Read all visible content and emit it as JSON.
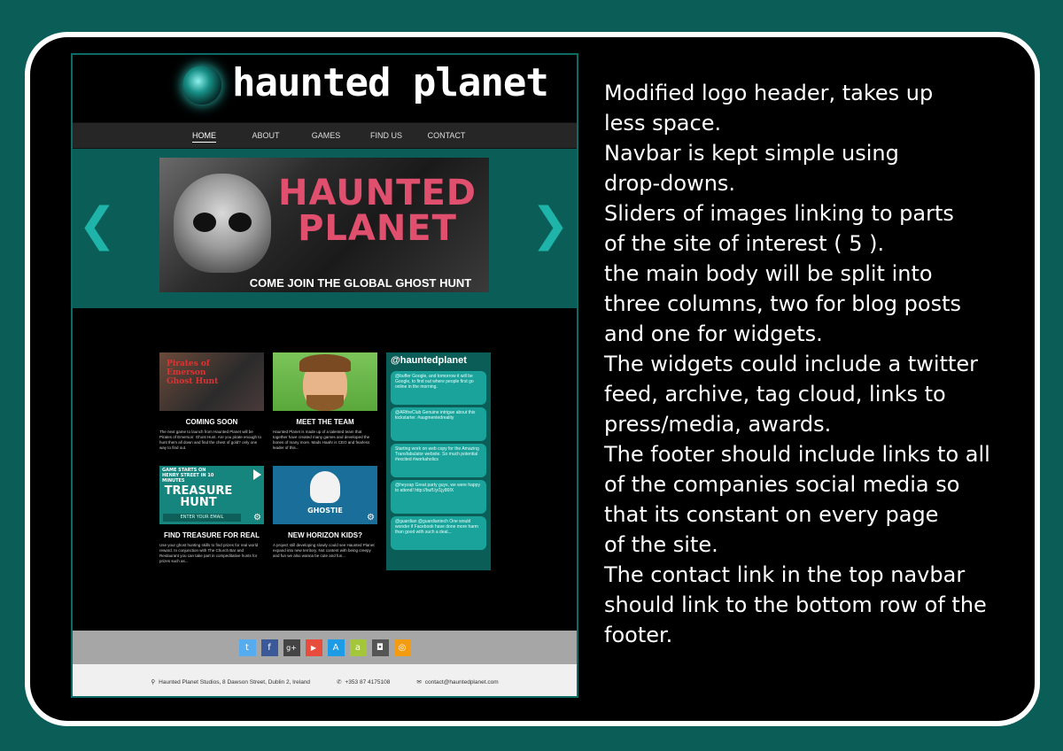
{
  "site": {
    "logo_text": "haunted planet",
    "nav": [
      "HOME",
      "ABOUT",
      "GAMES",
      "FIND US",
      "CONTACT"
    ],
    "slider": {
      "prev_icon": "chevron-left",
      "next_icon": "chevron-right",
      "title_line1": "HAUNTED",
      "title_line2": "PLANET",
      "caption": "COME JOIN THE GLOBAL GHOST HUNT"
    },
    "posts": [
      {
        "thumb_text": "Pirates of Emerson Ghost Hunt",
        "title": "COMING SOON",
        "text": "The next game to launch from Haunted Planet will be Pirates of Emerson: Ghost Hunt. Are you pirate enough to hunt them all down and find the chest of gold? only one way to find out."
      },
      {
        "thumb_text": "",
        "title": "MEET THE TEAM",
        "text": "Haunted Planet is made up of a talented team that together have created many games and developed the bones of many more. Mads Haahr is CEO and fearless leader of this..."
      },
      {
        "thumb_text": "GAME STARTS ON HENRY STREET IN 10 MINUTES",
        "thumb_title": "TREASURE HUNT",
        "thumb_input": "ENTER YOUR EMAIL",
        "title": "FIND TREASURE FOR REAL",
        "text": "Use your ghost hunting skills to find prizes for real world reward. In conjunction with The Church Bar and Restaurant you can take part in compeditative hunts for prizes such as..."
      },
      {
        "thumb_text": "GHOSTIE",
        "title": "NEW HORIZON KIDS?",
        "text": "A project still developing slowly could see Haunted Planet expand into new territory. Not content with being creepy and fun we also wanna be cute and fun..."
      }
    ],
    "widget": {
      "title": "@hauntedplanet",
      "tweets": [
        "@buffer Google, and tomorrow it will be Google, to find out where people first go online in the morning.",
        "@ARtheClub Genuine intrigue about this kickstarter. #augmentedreality",
        "Starting work on web copy for the Amazing Transfabulator website. So much potential #excited #workaholics",
        "@heyzap Great party guys, we were happy to attend! http://buff.ly/1jy86fX",
        "@guardian @guardiantech One would wonder if Facebook have done more harm than good with such a deal..."
      ]
    },
    "social": [
      {
        "name": "twitter",
        "glyph": "t",
        "color": "#55acee"
      },
      {
        "name": "facebook",
        "glyph": "f",
        "color": "#3b5998"
      },
      {
        "name": "google-plus",
        "glyph": "g+",
        "color": "#444444"
      },
      {
        "name": "youtube",
        "glyph": "▶",
        "color": "#e74c3c"
      },
      {
        "name": "app-store",
        "glyph": "A",
        "color": "#1d9ce5"
      },
      {
        "name": "android",
        "glyph": "a",
        "color": "#a4c639"
      },
      {
        "name": "instagram",
        "glyph": "◘",
        "color": "#555555"
      },
      {
        "name": "rss",
        "glyph": "◎",
        "color": "#f39c12"
      }
    ],
    "contact": {
      "address": "Haunted Planet Studios, 8 Dawson Street, Dublin 2, Ireland",
      "phone": "+353 87 4175108",
      "email": "contact@hauntedplanet.com"
    }
  },
  "notes": [
    "Modified logo header, takes up",
    "less space.",
    "Navbar is kept simple using",
    "drop-downs.",
    "Sliders of images linking to parts",
    "of the site of interest ( 5 ).",
    "the main body will be split into",
    "three columns, two for blog posts",
    "and one for widgets.",
    "The widgets could include a twitter",
    "feed, archive, tag cloud, links to",
    "press/media, awards.",
    "The footer should include links to all",
    "of the companies social media so",
    "that its constant on every page",
    "of the site.",
    "The contact link in the top navbar",
    "should link to the bottom row of the",
    "footer."
  ]
}
